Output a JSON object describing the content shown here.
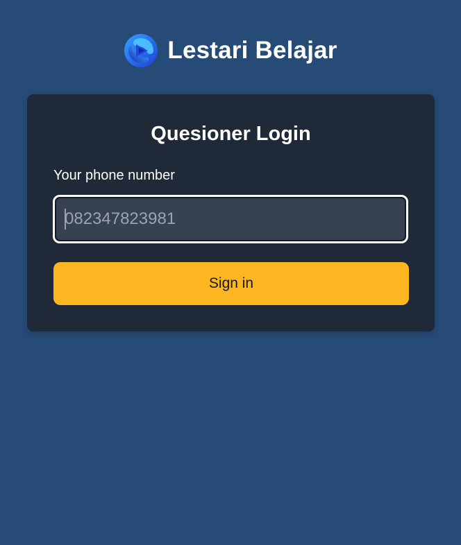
{
  "brand": {
    "name": "Lestari Belajar",
    "logo_icon": "swirl-logo-icon"
  },
  "login": {
    "title": "Quesioner Login",
    "phone_label": "Your phone number",
    "phone_value": "",
    "phone_placeholder": "082347823981",
    "signin_label": "Sign in"
  },
  "colors": {
    "background": "#274b77",
    "card": "#1f2937",
    "input_bg": "#374151",
    "button": "#fbb621",
    "button_text": "#111827",
    "logo_blue": "#1f6fe5"
  }
}
